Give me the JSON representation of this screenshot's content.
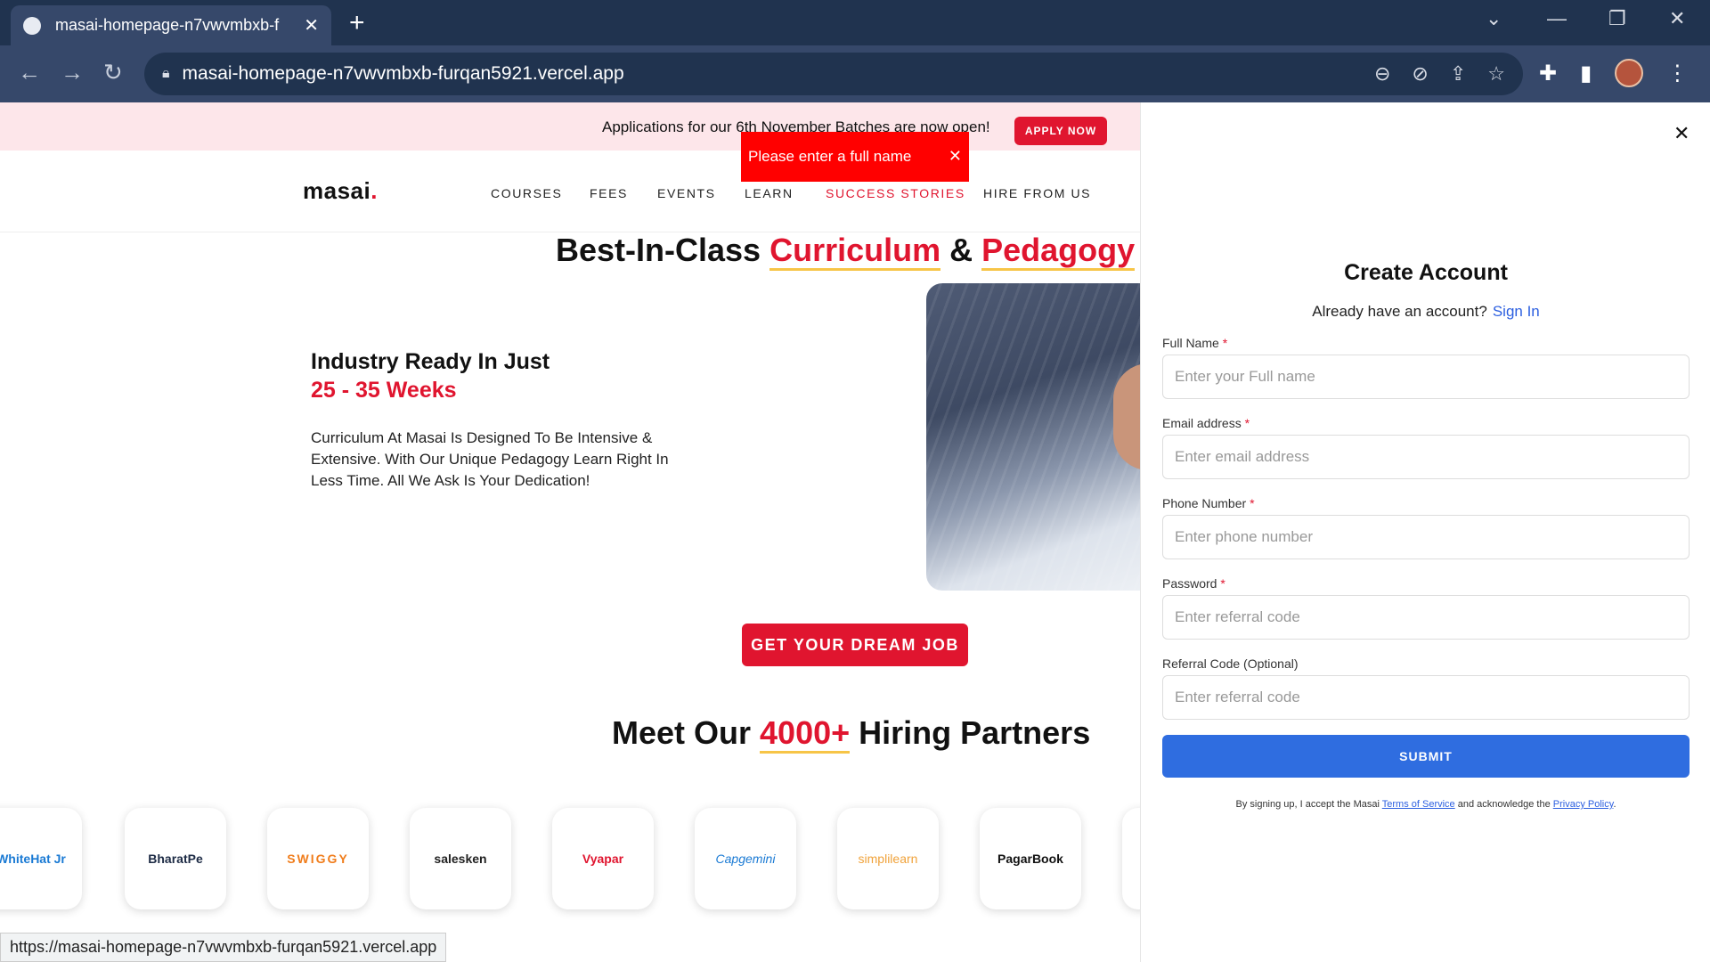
{
  "browser": {
    "tab_title": "masai-homepage-n7vwvmbxb-f",
    "url": "masai-homepage-n7vwvmbxb-furqan5921.vercel.app",
    "status_url": "https://masai-homepage-n7vwvmbxb-furqan5921.vercel.app"
  },
  "announcement": {
    "text": "Applications for our 6th November Batches are now open!",
    "button": "APPLY NOW"
  },
  "toast": {
    "message": "Please enter a full name"
  },
  "header": {
    "logo": "masai",
    "nav": [
      "COURSES",
      "FEES",
      "EVENTS",
      "LEARN",
      "SUCCESS STORIES",
      "HIRE FROM US"
    ]
  },
  "curriculum": {
    "title_1": "Best-In-Class ",
    "title_2": "Curriculum",
    "title_3": " & ",
    "title_4": "Pedagogy",
    "heading": "Industry Ready In Just",
    "weeks": "25 - 35 Weeks",
    "description": "Curriculum At Masai Is Designed To Be Intensive & Extensive. With Our Unique Pedagogy Learn Right In Less Time. All We Ask Is Your Dedication!",
    "cta": "GET YOUR DREAM JOB"
  },
  "partners": {
    "title_1": "Meet Our ",
    "title_2": "4000+",
    "title_3": " Hiring Partners",
    "logos": [
      "WhiteHat Jr",
      "BharatPe",
      "SWIGGY",
      "salesken",
      "Vyapar",
      "Capgemini",
      "simplilearn",
      "PagarBook"
    ]
  },
  "signup": {
    "title": "Create Account",
    "already": "Already have an account?",
    "signin": "Sign In",
    "fields": [
      {
        "label": "Full Name",
        "placeholder": "Enter your Full name"
      },
      {
        "label": "Email address",
        "placeholder": "Enter email address"
      },
      {
        "label": "Phone Number",
        "placeholder": "Enter phone number"
      },
      {
        "label": "Password",
        "placeholder": "Enter referral code"
      },
      {
        "label": "Referral Code (Optional)",
        "placeholder": "Enter referral code"
      }
    ],
    "required_mark": "*",
    "submit": "SUBMIT",
    "terms_1": "By signing up, I accept the Masai ",
    "terms_link_1": "Terms of Service",
    "terms_2": " and acknowledge the ",
    "terms_link_2": "Privacy Policy",
    "terms_3": "."
  },
  "colors": {
    "brand_red": "#e0152f",
    "primary_blue": "#2f6de0",
    "announce_bg": "#fde6ea"
  }
}
